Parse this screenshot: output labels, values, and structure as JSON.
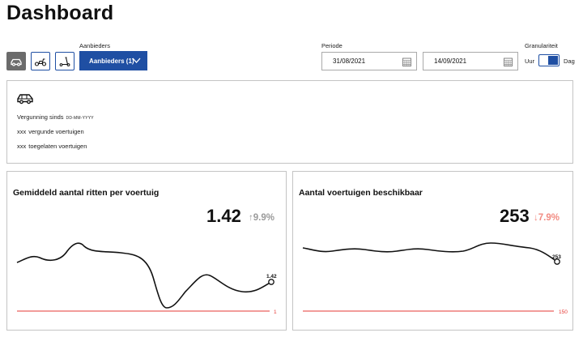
{
  "page": {
    "title": "Dashboard"
  },
  "filters": {
    "vehicle_types": [
      {
        "icon": "car-icon",
        "active": true
      },
      {
        "icon": "scooter-icon",
        "active": false
      },
      {
        "icon": "kickscooter-icon",
        "active": false
      }
    ],
    "providers_label": "Aanbieders",
    "providers_dropdown": "Aanbieders (1)",
    "period_label": "Periode",
    "date_from": "31/08/2021",
    "date_to": "14/09/2021",
    "granularity_label": "Granulariteit",
    "granularity_left": "Uur",
    "granularity_right": "Dag",
    "granularity_selected": "Dag"
  },
  "info": {
    "icon": "car-icon",
    "license_label": "Vergunning sinds",
    "license_date_placeholder": "DD-MM-YYYY",
    "licensed_count": "xxx",
    "licensed_label": "vergunde voertuigen",
    "admitted_count": "xxx",
    "admitted_label": "toegelaten voertuigen"
  },
  "cards": [
    {
      "title": "Gemiddeld aantal ritten per voertuig",
      "value": "1.42",
      "change": "9.9%",
      "change_direction": "up",
      "change_color": "#9a9a9a",
      "threshold_label": "1",
      "end_label": "1.42"
    },
    {
      "title": "Aantal voertuigen beschikbaar",
      "value": "253",
      "change": "7.9%",
      "change_direction": "down",
      "change_color": "#f28b82",
      "threshold_label": "150",
      "end_label": "253"
    }
  ],
  "colors": {
    "accent": "#1f4fa3",
    "threshold": "#e53935",
    "border": "#c4c4c4"
  }
}
